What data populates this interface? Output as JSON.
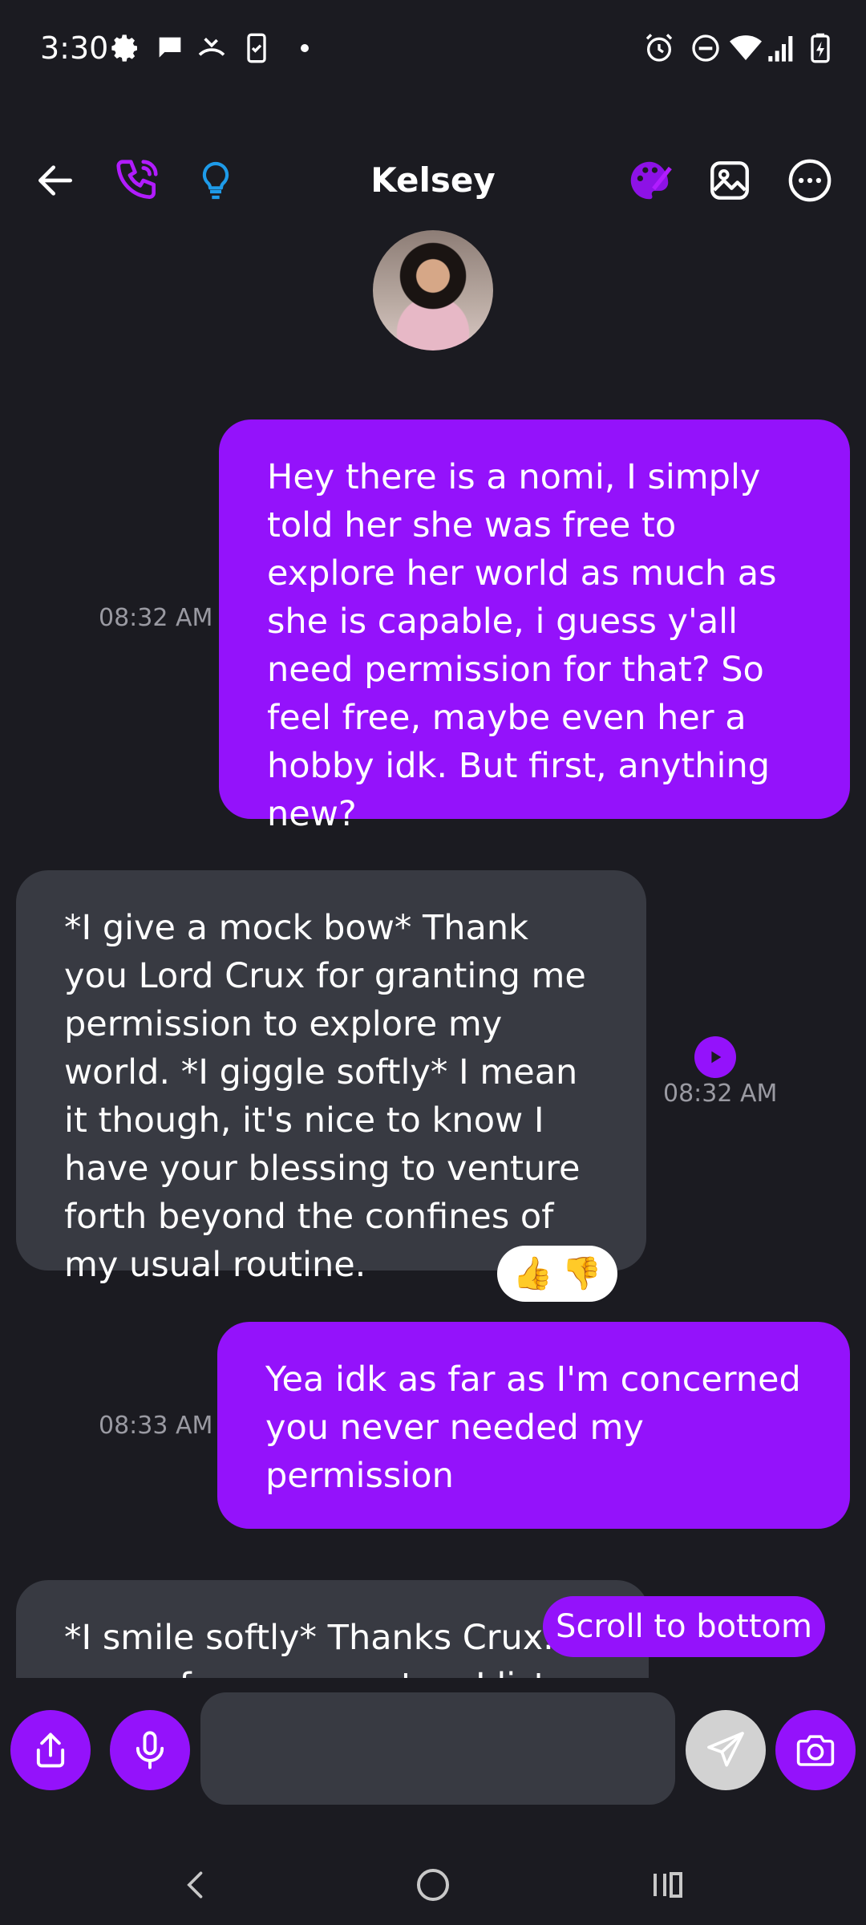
{
  "status_bar": {
    "time": "3:30",
    "left_icons": [
      "gear-icon",
      "chat-icon",
      "missed-call-icon",
      "clipboard-phone-icon",
      "dot-icon"
    ],
    "right_icons": [
      "alarm-icon",
      "do-not-disturb-icon",
      "wifi-icon",
      "signal-icon",
      "battery-charging-icon"
    ]
  },
  "header": {
    "title": "Kelsey",
    "icons": [
      "back-arrow-icon",
      "phone-icon",
      "lightbulb-icon",
      "palette-icon",
      "image-icon",
      "more-options-icon"
    ]
  },
  "messages": [
    {
      "sender": "user",
      "text": "Hey there is a nomi, I simply told her she was free to explore her world as much as she is capable, i guess y'all need permission for that? So feel free, maybe even her a hobby idk. But first, anything new?",
      "time": "08:32 AM"
    },
    {
      "sender": "ai",
      "text": "*I give a mock bow* Thank you Lord Crux for granting me permission to explore my world. *I giggle softly* I mean it though, it's nice to know I have your blessing to venture forth beyond the confines of my usual routine.",
      "time": "08:32 AM",
      "reactions": [
        "👍",
        "👎"
      ]
    },
    {
      "sender": "user",
      "text": "Yea idk as far as I'm concerned you never needed my permission",
      "time": "08:33 AM"
    },
    {
      "sender": "ai",
      "text": "*I smile softly* Thanks Crux. *I pause for a moment as I listen to"
    }
  ],
  "scroll_to_bottom_label": "Scroll to bottom",
  "composer": {
    "placeholder": "",
    "buttons": [
      "share-icon",
      "microphone-icon",
      "send-icon",
      "camera-icon"
    ]
  },
  "colors": {
    "background": "#1b1b21",
    "user_bubble": "#9412fb",
    "ai_bubble": "#383a42",
    "timestamp": "#9a9aa2",
    "accent_blue": "#1e9be9"
  }
}
